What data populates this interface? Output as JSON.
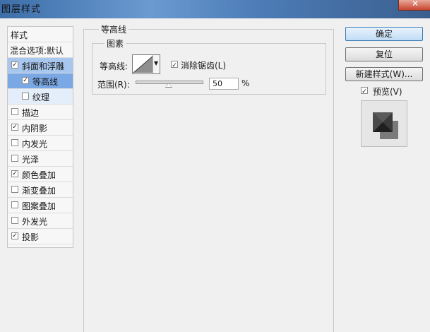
{
  "window": {
    "title": "图层样式"
  },
  "left_list": {
    "header": "样式",
    "blend_options": "混合选项:默认",
    "items": [
      {
        "label": "斜面和浮雕",
        "checked": true
      },
      {
        "label": "等高线",
        "checked": true
      },
      {
        "label": "纹理",
        "checked": false
      },
      {
        "label": "描边",
        "checked": false
      },
      {
        "label": "内阴影",
        "checked": true
      },
      {
        "label": "内发光",
        "checked": false
      },
      {
        "label": "光泽",
        "checked": false
      },
      {
        "label": "颜色叠加",
        "checked": true
      },
      {
        "label": "渐变叠加",
        "checked": false
      },
      {
        "label": "图案叠加",
        "checked": false
      },
      {
        "label": "外发光",
        "checked": false
      },
      {
        "label": "投影",
        "checked": true
      }
    ]
  },
  "panel": {
    "group_title": "等高线",
    "subgroup_title": "图素",
    "contour_label": "等高线:",
    "antialias_label": "消除锯齿(L)",
    "antialias_checked": true,
    "range_label": "范围(R):",
    "range_value": "50",
    "range_unit": "%",
    "range_fraction": 0.5
  },
  "buttons": {
    "ok": "确定",
    "reset": "复位",
    "new_style": "新建样式(W)..."
  },
  "preview": {
    "label": "预览(V)",
    "checked": true
  },
  "colors": {
    "selected_row": "#a7c7ee",
    "subselected_row": "#79a8e4",
    "preview_dark": "#3c3c3c",
    "preview_mid": "#7a7a7a"
  }
}
